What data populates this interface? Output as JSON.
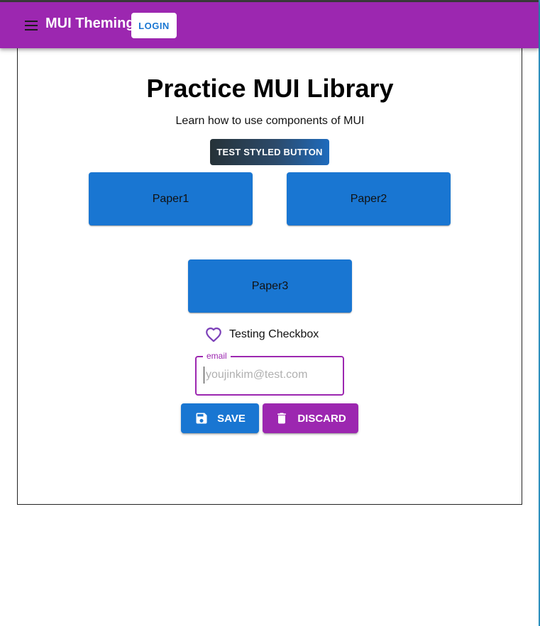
{
  "appbar": {
    "title": "MUI Theming",
    "login_label": "LOGIN",
    "background": "#9c27b0",
    "menu_icon": "menu-icon"
  },
  "main": {
    "title": "Practice MUI Library",
    "subtitle": "Learn how to use components of MUI",
    "styled_button_label": "TEST STYLED BUTTON",
    "papers": [
      {
        "label": "Paper1"
      },
      {
        "label": "Paper2"
      },
      {
        "label": "Paper3"
      }
    ],
    "paper_color": "#1976d2",
    "checkbox": {
      "label": "Testing Checkbox",
      "icon": "heart-outline-icon",
      "checked": false,
      "color": "#9c27b0"
    },
    "email_field": {
      "label": "email",
      "placeholder": "youjinkim@test.com",
      "value": ""
    },
    "save_button": {
      "label": "SAVE",
      "icon": "save-icon",
      "color": "#1976d2"
    },
    "discard_button": {
      "label": "DISCARD",
      "icon": "trash-icon",
      "color": "#9c27b0"
    }
  }
}
